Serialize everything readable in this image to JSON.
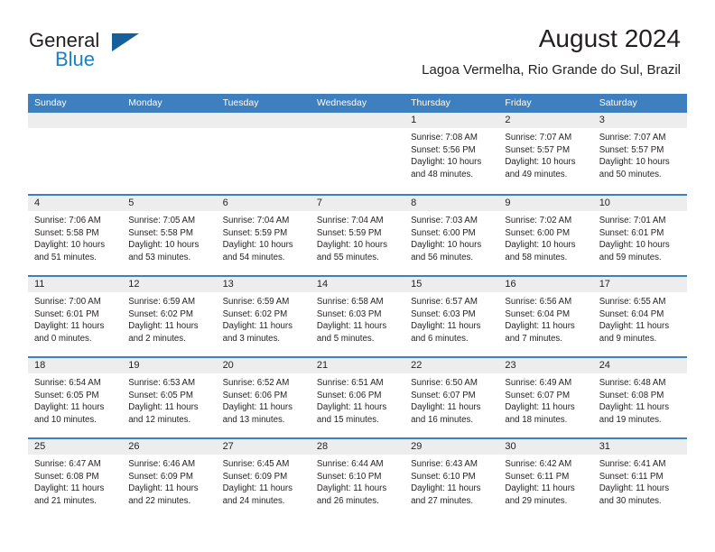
{
  "brand": {
    "name_part1": "General",
    "name_part2": "Blue",
    "accent_color": "#1b80c4",
    "triangle_color": "#15609b"
  },
  "header": {
    "month_title": "August 2024",
    "location": "Lagoa Vermelha, Rio Grande do Sul, Brazil"
  },
  "calendar": {
    "header_bg": "#3e7fbf",
    "date_band_bg": "#ededed",
    "weekday_names": [
      "Sunday",
      "Monday",
      "Tuesday",
      "Wednesday",
      "Thursday",
      "Friday",
      "Saturday"
    ],
    "weeks": [
      [
        {
          "date": "",
          "lines": []
        },
        {
          "date": "",
          "lines": []
        },
        {
          "date": "",
          "lines": []
        },
        {
          "date": "",
          "lines": []
        },
        {
          "date": "1",
          "lines": [
            "Sunrise: 7:08 AM",
            "Sunset: 5:56 PM",
            "Daylight: 10 hours",
            "and 48 minutes."
          ]
        },
        {
          "date": "2",
          "lines": [
            "Sunrise: 7:07 AM",
            "Sunset: 5:57 PM",
            "Daylight: 10 hours",
            "and 49 minutes."
          ]
        },
        {
          "date": "3",
          "lines": [
            "Sunrise: 7:07 AM",
            "Sunset: 5:57 PM",
            "Daylight: 10 hours",
            "and 50 minutes."
          ]
        }
      ],
      [
        {
          "date": "4",
          "lines": [
            "Sunrise: 7:06 AM",
            "Sunset: 5:58 PM",
            "Daylight: 10 hours",
            "and 51 minutes."
          ]
        },
        {
          "date": "5",
          "lines": [
            "Sunrise: 7:05 AM",
            "Sunset: 5:58 PM",
            "Daylight: 10 hours",
            "and 53 minutes."
          ]
        },
        {
          "date": "6",
          "lines": [
            "Sunrise: 7:04 AM",
            "Sunset: 5:59 PM",
            "Daylight: 10 hours",
            "and 54 minutes."
          ]
        },
        {
          "date": "7",
          "lines": [
            "Sunrise: 7:04 AM",
            "Sunset: 5:59 PM",
            "Daylight: 10 hours",
            "and 55 minutes."
          ]
        },
        {
          "date": "8",
          "lines": [
            "Sunrise: 7:03 AM",
            "Sunset: 6:00 PM",
            "Daylight: 10 hours",
            "and 56 minutes."
          ]
        },
        {
          "date": "9",
          "lines": [
            "Sunrise: 7:02 AM",
            "Sunset: 6:00 PM",
            "Daylight: 10 hours",
            "and 58 minutes."
          ]
        },
        {
          "date": "10",
          "lines": [
            "Sunrise: 7:01 AM",
            "Sunset: 6:01 PM",
            "Daylight: 10 hours",
            "and 59 minutes."
          ]
        }
      ],
      [
        {
          "date": "11",
          "lines": [
            "Sunrise: 7:00 AM",
            "Sunset: 6:01 PM",
            "Daylight: 11 hours",
            "and 0 minutes."
          ]
        },
        {
          "date": "12",
          "lines": [
            "Sunrise: 6:59 AM",
            "Sunset: 6:02 PM",
            "Daylight: 11 hours",
            "and 2 minutes."
          ]
        },
        {
          "date": "13",
          "lines": [
            "Sunrise: 6:59 AM",
            "Sunset: 6:02 PM",
            "Daylight: 11 hours",
            "and 3 minutes."
          ]
        },
        {
          "date": "14",
          "lines": [
            "Sunrise: 6:58 AM",
            "Sunset: 6:03 PM",
            "Daylight: 11 hours",
            "and 5 minutes."
          ]
        },
        {
          "date": "15",
          "lines": [
            "Sunrise: 6:57 AM",
            "Sunset: 6:03 PM",
            "Daylight: 11 hours",
            "and 6 minutes."
          ]
        },
        {
          "date": "16",
          "lines": [
            "Sunrise: 6:56 AM",
            "Sunset: 6:04 PM",
            "Daylight: 11 hours",
            "and 7 minutes."
          ]
        },
        {
          "date": "17",
          "lines": [
            "Sunrise: 6:55 AM",
            "Sunset: 6:04 PM",
            "Daylight: 11 hours",
            "and 9 minutes."
          ]
        }
      ],
      [
        {
          "date": "18",
          "lines": [
            "Sunrise: 6:54 AM",
            "Sunset: 6:05 PM",
            "Daylight: 11 hours",
            "and 10 minutes."
          ]
        },
        {
          "date": "19",
          "lines": [
            "Sunrise: 6:53 AM",
            "Sunset: 6:05 PM",
            "Daylight: 11 hours",
            "and 12 minutes."
          ]
        },
        {
          "date": "20",
          "lines": [
            "Sunrise: 6:52 AM",
            "Sunset: 6:06 PM",
            "Daylight: 11 hours",
            "and 13 minutes."
          ]
        },
        {
          "date": "21",
          "lines": [
            "Sunrise: 6:51 AM",
            "Sunset: 6:06 PM",
            "Daylight: 11 hours",
            "and 15 minutes."
          ]
        },
        {
          "date": "22",
          "lines": [
            "Sunrise: 6:50 AM",
            "Sunset: 6:07 PM",
            "Daylight: 11 hours",
            "and 16 minutes."
          ]
        },
        {
          "date": "23",
          "lines": [
            "Sunrise: 6:49 AM",
            "Sunset: 6:07 PM",
            "Daylight: 11 hours",
            "and 18 minutes."
          ]
        },
        {
          "date": "24",
          "lines": [
            "Sunrise: 6:48 AM",
            "Sunset: 6:08 PM",
            "Daylight: 11 hours",
            "and 19 minutes."
          ]
        }
      ],
      [
        {
          "date": "25",
          "lines": [
            "Sunrise: 6:47 AM",
            "Sunset: 6:08 PM",
            "Daylight: 11 hours",
            "and 21 minutes."
          ]
        },
        {
          "date": "26",
          "lines": [
            "Sunrise: 6:46 AM",
            "Sunset: 6:09 PM",
            "Daylight: 11 hours",
            "and 22 minutes."
          ]
        },
        {
          "date": "27",
          "lines": [
            "Sunrise: 6:45 AM",
            "Sunset: 6:09 PM",
            "Daylight: 11 hours",
            "and 24 minutes."
          ]
        },
        {
          "date": "28",
          "lines": [
            "Sunrise: 6:44 AM",
            "Sunset: 6:10 PM",
            "Daylight: 11 hours",
            "and 26 minutes."
          ]
        },
        {
          "date": "29",
          "lines": [
            "Sunrise: 6:43 AM",
            "Sunset: 6:10 PM",
            "Daylight: 11 hours",
            "and 27 minutes."
          ]
        },
        {
          "date": "30",
          "lines": [
            "Sunrise: 6:42 AM",
            "Sunset: 6:11 PM",
            "Daylight: 11 hours",
            "and 29 minutes."
          ]
        },
        {
          "date": "31",
          "lines": [
            "Sunrise: 6:41 AM",
            "Sunset: 6:11 PM",
            "Daylight: 11 hours",
            "and 30 minutes."
          ]
        }
      ]
    ]
  }
}
